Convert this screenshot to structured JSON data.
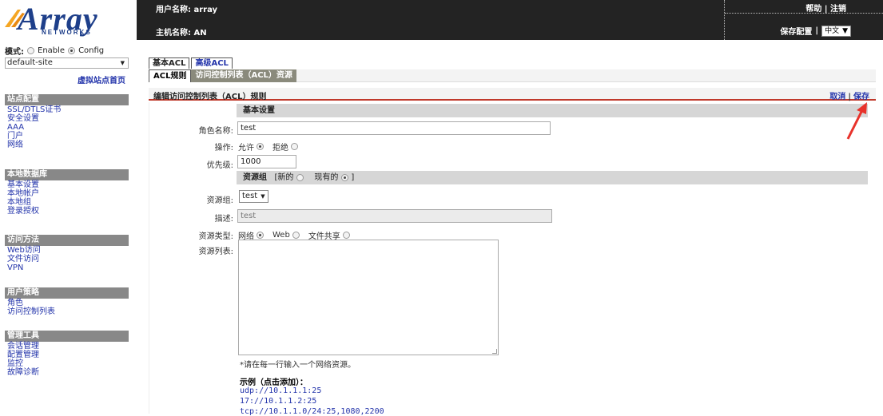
{
  "header": {
    "logo_text": "Array",
    "logo_sub": "NETWORKS",
    "user_label": "用户名称: array",
    "host_label": "主机名称: AN",
    "help": "帮助",
    "logout": "注销",
    "save_config": "保存配置",
    "lang": "中文",
    "brand_color": "#1e3f8a"
  },
  "sidebar": {
    "mode_label": "模式:",
    "mode_options": [
      "Enable",
      "Config"
    ],
    "mode_selected": "Config",
    "site_select": "default-site",
    "vhome": "虚拟站点首页",
    "sections": [
      {
        "title": "站点配置",
        "items": [
          "SSL/DTLS证书",
          "安全设置",
          "AAA",
          "门户",
          "网络"
        ]
      },
      {
        "title": "本地数据库",
        "items": [
          "基本设置",
          "本地帐户",
          "本地组",
          "登录授权"
        ]
      },
      {
        "title": "访问方法",
        "items": [
          "Web访问",
          "文件访问",
          "VPN"
        ]
      },
      {
        "title": "用户策略",
        "items": [
          "角色",
          "访问控制列表"
        ]
      },
      {
        "title": "管理工具",
        "items": [
          "会话管理",
          "配置管理",
          "监控",
          "故障诊断"
        ]
      }
    ]
  },
  "main": {
    "tabs": [
      "基本ACL",
      "高级ACL"
    ],
    "subtabs": [
      "ACL规则",
      "访问控制列表（ACL）资源"
    ],
    "panel_title": "编辑访问控制列表（ACL）规则",
    "cancel": "取消",
    "save": "保存",
    "basic_section": "基本设置",
    "role_label": "角色名称:",
    "role_value": "test",
    "action_label": "操作:",
    "action_allow": "允许",
    "action_deny": "拒绝",
    "priority_label": "优先级:",
    "priority_value": "1000",
    "resgroup_section": "资源组",
    "resgroup_new": "[新的",
    "resgroup_existing": "现有的",
    "resgroup_close": "]",
    "group_label": "资源组:",
    "group_value": "test",
    "desc_label": "描述:",
    "desc_value": "test",
    "restype_label": "资源类型:",
    "restype_net": "网络",
    "restype_web": "Web",
    "restype_share": "文件共享",
    "reslist_label": "资源列表:",
    "hint": "*请在每一行输入一个网络资源。",
    "example_title": "示例（点击添加）：",
    "examples": [
      "udp://10.1.1.1:25",
      "17://10.1.1.2:25",
      "tcp://10.1.1.0/24:25,1080,2200"
    ],
    "arrow_color": "#e8322b"
  }
}
